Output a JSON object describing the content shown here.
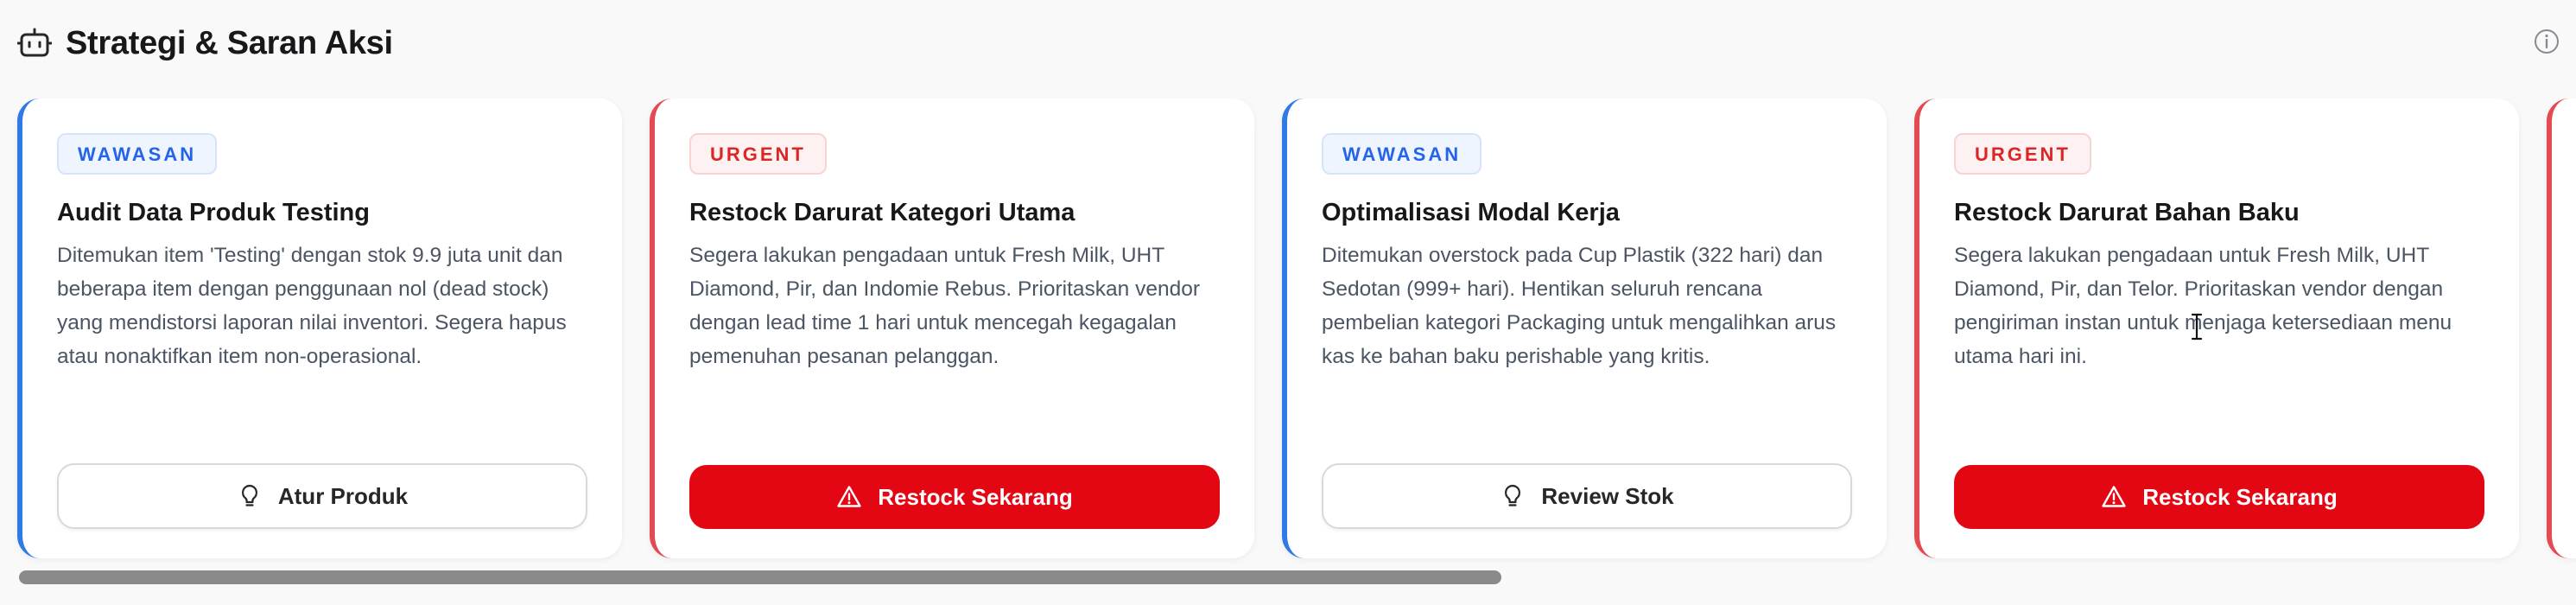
{
  "header": {
    "title": "Strategi & Saran Aksi",
    "icon": "robot-icon",
    "info_icon": "info-icon"
  },
  "cards": [
    {
      "badge": "WAWASAN",
      "type": "info",
      "title": "Audit Data Produk Testing",
      "description": "Ditemukan item 'Testing' dengan stok 9.9 juta unit dan beberapa item dengan penggunaan nol (dead stock) yang mendistorsi laporan nilai inventori. Segera hapus atau nonaktifkan item non-operasional.",
      "button": "Atur Produk",
      "button_icon": "lightbulb-icon"
    },
    {
      "badge": "URGENT",
      "type": "urgent",
      "title": "Restock Darurat Kategori Utama",
      "description": "Segera lakukan pengadaan untuk Fresh Milk, UHT Diamond, Pir, dan Indomie Rebus. Prioritaskan vendor dengan lead time 1 hari untuk mencegah kegagalan pemenuhan pesanan pelanggan.",
      "button": "Restock Sekarang",
      "button_icon": "warning-icon"
    },
    {
      "badge": "WAWASAN",
      "type": "info",
      "title": "Optimalisasi Modal Kerja",
      "description": "Ditemukan overstock pada Cup Plastik (322 hari) dan Sedotan (999+ hari). Hentikan seluruh rencana pembelian kategori Packaging untuk mengalihkan arus kas ke bahan baku perishable yang kritis.",
      "button": "Review Stok",
      "button_icon": "lightbulb-icon"
    },
    {
      "badge": "URGENT",
      "type": "urgent",
      "title": "Restock Darurat Bahan Baku",
      "description": "Segera lakukan pengadaan untuk Fresh Milk, UHT Diamond, Pir, dan Telor. Prioritaskan vendor dengan pengiriman instan untuk menjaga ketersediaan menu utama hari ini.",
      "button": "Restock Sekarang",
      "button_icon": "warning-icon"
    }
  ],
  "colors": {
    "info_accent": "#2f7ae5",
    "urgent_accent": "#e34a52",
    "primary_button": "#e30613"
  }
}
